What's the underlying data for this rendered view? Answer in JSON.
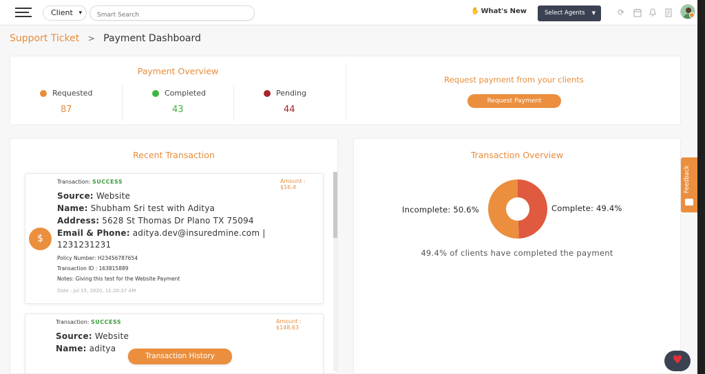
{
  "topbar": {
    "client_select": "Client",
    "search_placeholder": "Smart Search",
    "whats_new": "What's New",
    "select_agents": "Select Agents",
    "icons": [
      "sync-icon",
      "calendar-icon",
      "bell-icon",
      "document-icon"
    ]
  },
  "breadcrumb": {
    "parent": "Support Ticket",
    "separator": ">",
    "current": "Payment Dashboard"
  },
  "payment_overview": {
    "title": "Payment Overview",
    "stats": [
      {
        "label": "Requested",
        "value": "87",
        "color": "#e88c3a"
      },
      {
        "label": "Completed",
        "value": "43",
        "color": "#3eb53e"
      },
      {
        "label": "Pending",
        "value": "44",
        "color": "#a8242a"
      }
    ],
    "request_text": "Request payment from your clients",
    "request_button": "Request Payment"
  },
  "recent_transaction": {
    "title": "Recent Transaction",
    "items": [
      {
        "status_label": "Transaction:",
        "status": "SUCCESS",
        "amount_label": "Amount :",
        "amount": "$16.4",
        "source_label": "Source:",
        "source": "Website",
        "name_label": "Name:",
        "name": "Shubham Sri test with Aditya",
        "address_label": "Address:",
        "address": "5628 St Thomas Dr Plano TX 75094",
        "contact_label": "Email & Phone:",
        "contact_line1": "aditya.dev@insuredmine.com |",
        "contact_line2": "1231231231",
        "policy": "Policy Number: H23456787654",
        "transaction_id": "Transaction ID : 163815889",
        "notes": "Notes: Giving this test for the Website Payment",
        "date": "Date : Jul 15, 2020, 11:20:37 AM"
      },
      {
        "status_label": "Transaction:",
        "status": "SUCCESS",
        "amount_label": "Amount :",
        "amount": "$148.63",
        "source_label": "Source:",
        "source": "Website",
        "name_label": "Name:",
        "name": "aditya"
      }
    ],
    "history_button": "Transaction History"
  },
  "transaction_overview": {
    "title": "Transaction Overview",
    "incomplete_label": "Incomplete: 50.6%",
    "complete_label": "Complete: 49.4%",
    "caption": "49.4% of clients have completed the payment"
  },
  "chart_data": {
    "type": "pie",
    "categories": [
      "Incomplete",
      "Complete"
    ],
    "values": [
      50.6,
      49.4
    ],
    "colors": [
      "#eb8f3e",
      "#df5a3e"
    ],
    "title": "Transaction Overview"
  },
  "feedback_tab": "Feedback"
}
